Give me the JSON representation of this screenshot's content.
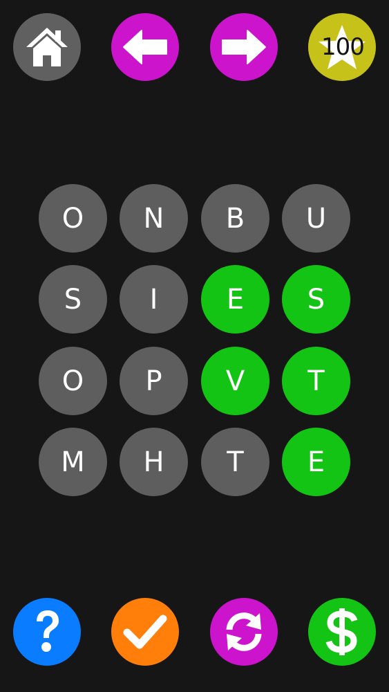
{
  "colors": {
    "background": "#161616",
    "home": "#606060",
    "nav_arrows": "#cc14cc",
    "score_badge": "#c6c21a",
    "tile_default": "#5e5e5e",
    "tile_selected": "#14c414",
    "help": "#0a7cff",
    "submit": "#ff7f0a",
    "shuffle": "#cc14cc",
    "shop": "#14c414"
  },
  "top_bar": {
    "home_icon": "house-icon",
    "back_icon": "arrow-left-icon",
    "next_icon": "arrow-right-icon",
    "score_icon": "star-icon",
    "score": "100"
  },
  "board": {
    "rows": 4,
    "cols": 4,
    "tiles": [
      {
        "letter": "O",
        "selected": false
      },
      {
        "letter": "N",
        "selected": false
      },
      {
        "letter": "B",
        "selected": false
      },
      {
        "letter": "U",
        "selected": false
      },
      {
        "letter": "S",
        "selected": false
      },
      {
        "letter": "I",
        "selected": false
      },
      {
        "letter": "E",
        "selected": true
      },
      {
        "letter": "S",
        "selected": true
      },
      {
        "letter": "O",
        "selected": false
      },
      {
        "letter": "P",
        "selected": false
      },
      {
        "letter": "V",
        "selected": true
      },
      {
        "letter": "T",
        "selected": true
      },
      {
        "letter": "M",
        "selected": false
      },
      {
        "letter": "H",
        "selected": false
      },
      {
        "letter": "T",
        "selected": false
      },
      {
        "letter": "E",
        "selected": true
      }
    ]
  },
  "bottom_bar": {
    "help_icon": "question-mark-icon",
    "submit_icon": "checkmark-icon",
    "shuffle_icon": "refresh-icon",
    "shop_icon": "dollar-icon"
  }
}
